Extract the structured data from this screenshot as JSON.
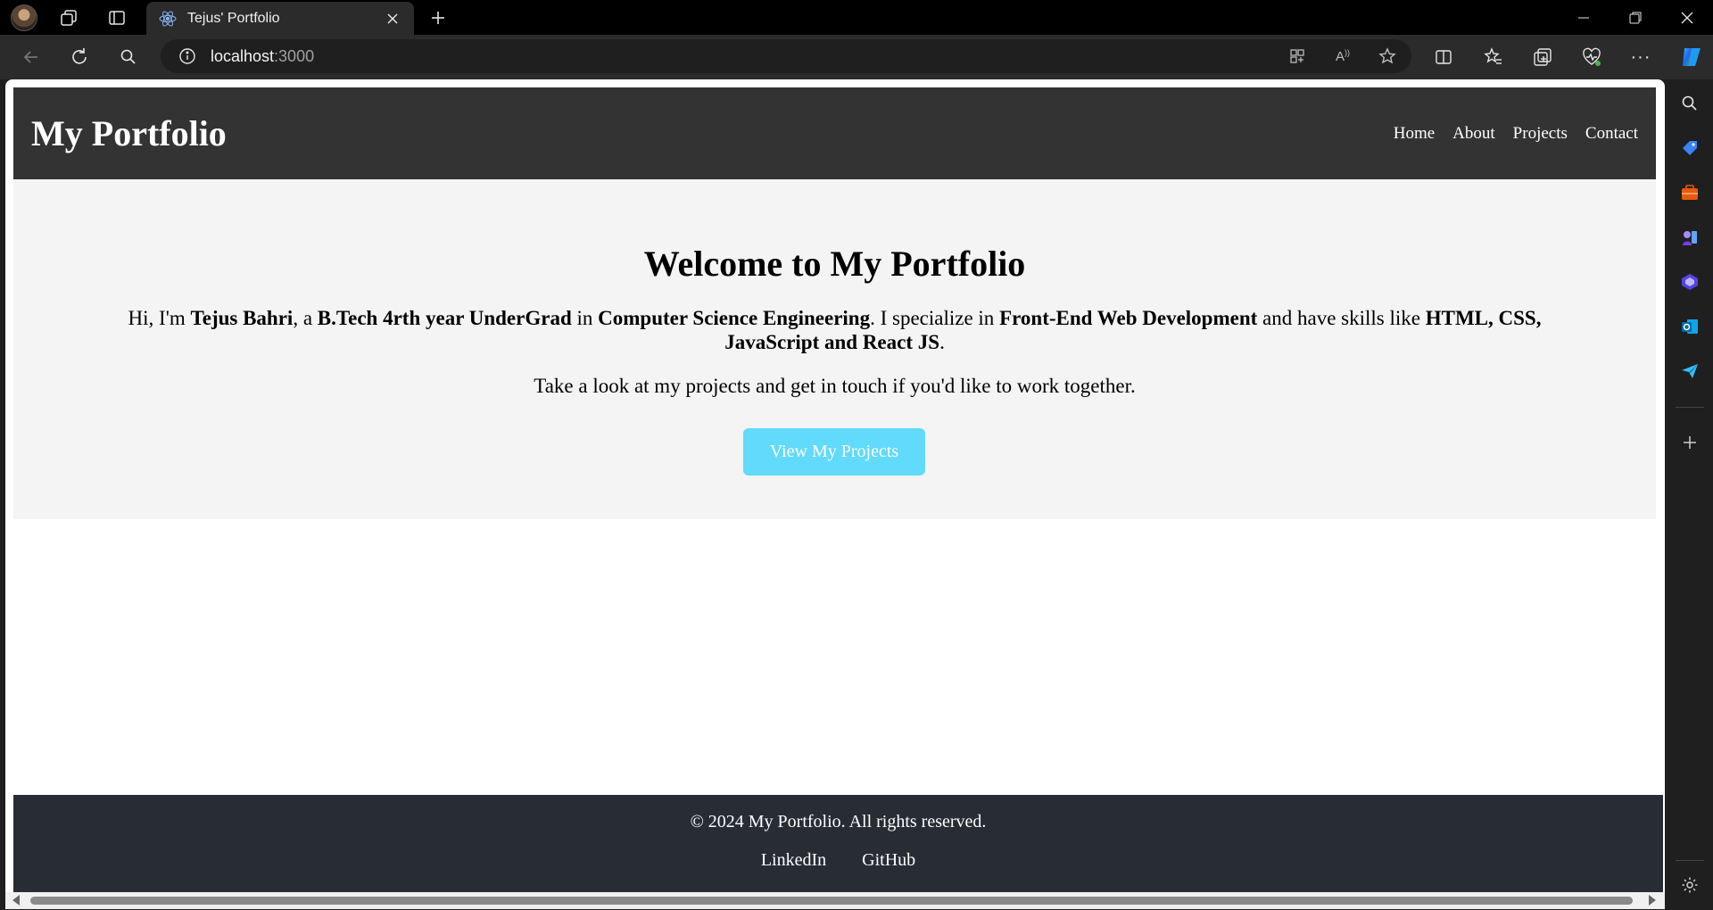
{
  "browser": {
    "tab_title": "Tejus' Portfolio",
    "url_host": "localhost",
    "url_port": ":3000"
  },
  "site": {
    "logo": "My Portfolio",
    "nav": [
      "Home",
      "About",
      "Projects",
      "Contact"
    ],
    "hero": {
      "heading": "Welcome to My Portfolio",
      "intro_parts": {
        "p1": "Hi, I'm ",
        "name": "Tejus Bahri",
        "p2": ", a ",
        "degree": "B.Tech 4rth year UnderGrad",
        "p3": " in ",
        "field": "Computer Science Engineering",
        "p4": ". I specialize in ",
        "specialty": "Front-End Web Development",
        "p5": " and have skills like ",
        "skills": "HTML, CSS, JavaScript and React JS",
        "p6": "."
      },
      "cta_text": "Take a look at my projects and get in touch if you'd like to work together.",
      "button_label": "View My Projects"
    },
    "footer": {
      "copyright": "© 2024 My Portfolio. All rights reserved.",
      "links": [
        "LinkedIn",
        "GitHub"
      ]
    }
  },
  "colors": {
    "header_bg": "#333333",
    "hero_bg": "#f4f4f4",
    "button_bg": "#61dafb",
    "footer_bg": "#282c34"
  }
}
